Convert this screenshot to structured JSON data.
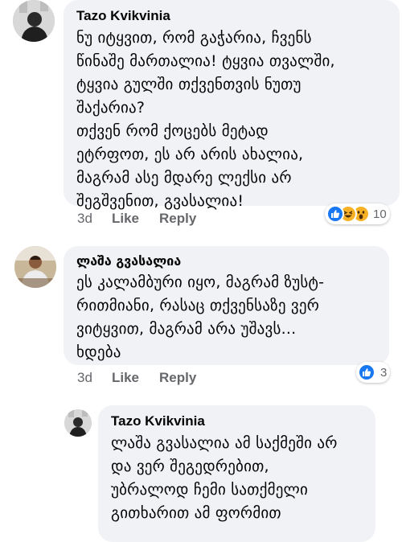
{
  "comments": [
    {
      "author": "Tazo Kvikvinia",
      "text": "ნუ იტყვით, რომ გაჭარია, ჩვენს\nწინაშე მართალია!  ტყვია თვალში,\nტყვია გულში თქვენთვის ნუთუ\nშაქარია?\nთქვენ რომ ქოცებს მეტად\nეტრფოთ, ეს არ არის ახალია,\nმაგრამ ასე მდარე ლექსი არ\nშეგშვენით, გვასალია!",
      "time": "3d",
      "like_label": "Like",
      "reply_label": "Reply",
      "reaction_icons": [
        "like-icon",
        "laugh-icon",
        "wow-icon"
      ],
      "reaction_count": "10"
    },
    {
      "author": "ლაშა გვასალია",
      "text": "ეს კალამბური იყო, მაგრამ ზუსტ-\nრითმიანი, რასაც თქვენსაზე ვერ\nვიტყვით, მაგრამ არა უშავს...\nხდება",
      "time": "3d",
      "like_label": "Like",
      "reply_label": "Reply",
      "reaction_icons": [
        "like-icon"
      ],
      "reaction_count": "3"
    },
    {
      "author": "Tazo Kvikvinia",
      "text": "ლაშა გვასალია ამ საქმეში არ\nდა ვერ შეგედრებით,\nუბრალოდ ჩემი სათქმელი\nგითხარით ამ ფორმით"
    }
  ],
  "colors": {
    "bubble": "#f0f2f5",
    "meta_text": "#65676b",
    "like_blue": "#1877f2",
    "emoji_yellow": "#f7b125"
  }
}
